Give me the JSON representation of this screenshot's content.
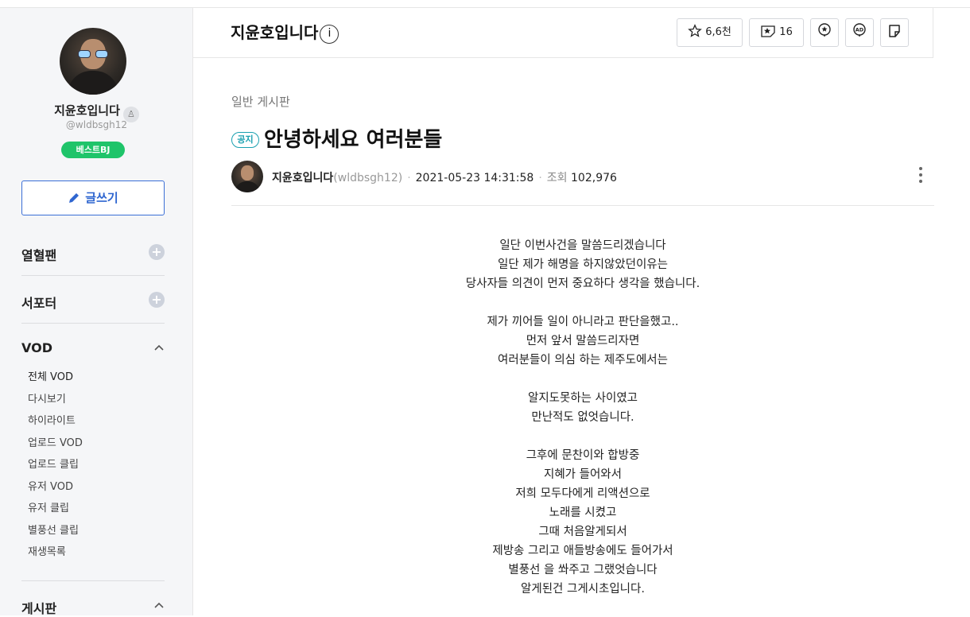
{
  "sidebar": {
    "name": "지윤호입니다",
    "user_id": "@wldbsgh12",
    "badge": "베스트BJ",
    "write_label": "글쓰기",
    "sections": [
      "열혈팬",
      "서포터"
    ],
    "vod_label": "VOD",
    "vod_items": [
      "전체 VOD",
      "다시보기",
      "하이라이트",
      "업로드 VOD",
      "업로드 클립",
      "유저 VOD",
      "유저 클립",
      "별풍선 클립",
      "재생목록"
    ],
    "board_label": "게시판"
  },
  "header": {
    "title": "지윤호입니다",
    "info_icon": "i",
    "favorite_count": "6,6천",
    "sub_count": "16"
  },
  "post": {
    "board": "일반 게시판",
    "notice_tag": "공지",
    "title": "안녕하세요 여러분들",
    "author": "지윤호입니다",
    "author_id": "(wldbsgh12)",
    "date": "2021-05-23 14:31:58",
    "views_label": "조회",
    "views": "102,976",
    "lines": [
      "일단 이번사건을 말씀드리겠습니다",
      "일단 제가 해명을 하지않았던이유는",
      "당사자들 의견이 먼저 중요하다 생각을 했습니다.",
      "",
      "제가 끼어들 일이 아니라고 판단을했고..",
      "먼저 앞서 말씀드리자면",
      "여러분들이 의심 하는 제주도에서는",
      "",
      "알지도못하는 사이였고",
      "만난적도 없엇습니다.",
      "",
      "그후에 문찬이와 합방중",
      "지혜가 들어와서",
      "저희 모두다에게 리액션으로",
      "노래를 시켰고",
      "그때 처음알게되서",
      "제방송 그리고 애들방송에도 들어가서",
      "별풍선 을 쏴주고 그랬엇습니다",
      "알게된건 그게시초입니다."
    ]
  }
}
